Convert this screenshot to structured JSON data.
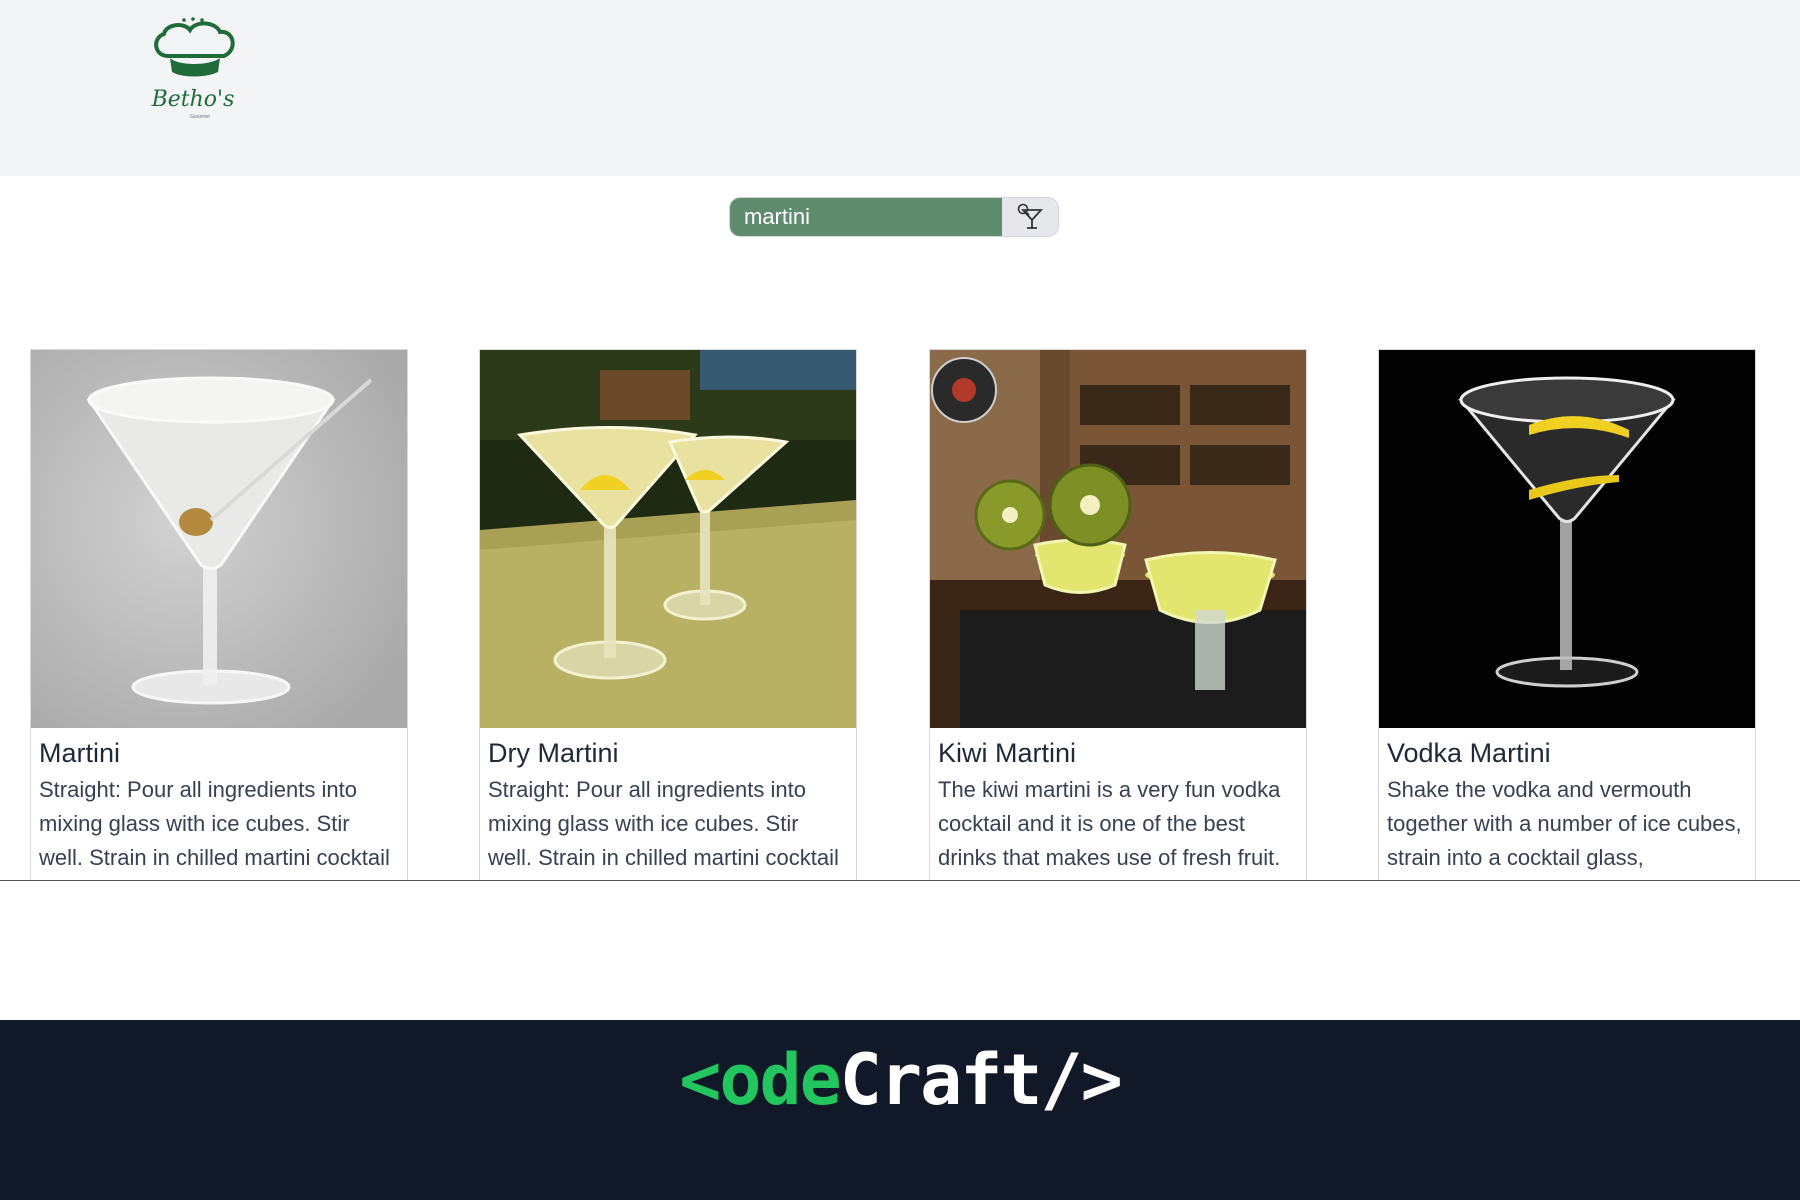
{
  "header": {
    "logo_text": "Betho's",
    "logo_subtext": "Gourmet"
  },
  "search": {
    "value": "martini",
    "button_icon": "cocktail-search-icon"
  },
  "drinks": [
    {
      "title": "Martini",
      "description": "Straight: Pour all ingredients into mixing glass with ice cubes. Stir well. Strain in chilled martini cocktail glass."
    },
    {
      "title": "Dry Martini",
      "description": "Straight: Pour all ingredients into mixing glass with ice cubes. Stir well. Strain in chilled martini cocktail glass."
    },
    {
      "title": "Kiwi Martini",
      "description": "The kiwi martini is a very fun vodka cocktail and it is one of the best drinks that makes use of fresh fruit."
    },
    {
      "title": "Vodka Martini",
      "description": "Shake the vodka and vermouth together with a number of ice cubes, strain into a cocktail glass,"
    }
  ],
  "footer": {
    "brand_green": "<ode",
    "brand_white": "Craft/>"
  },
  "colors": {
    "accent": "#5f8b6e",
    "footer_bg": "#111827",
    "brand_green": "#22c55e"
  }
}
